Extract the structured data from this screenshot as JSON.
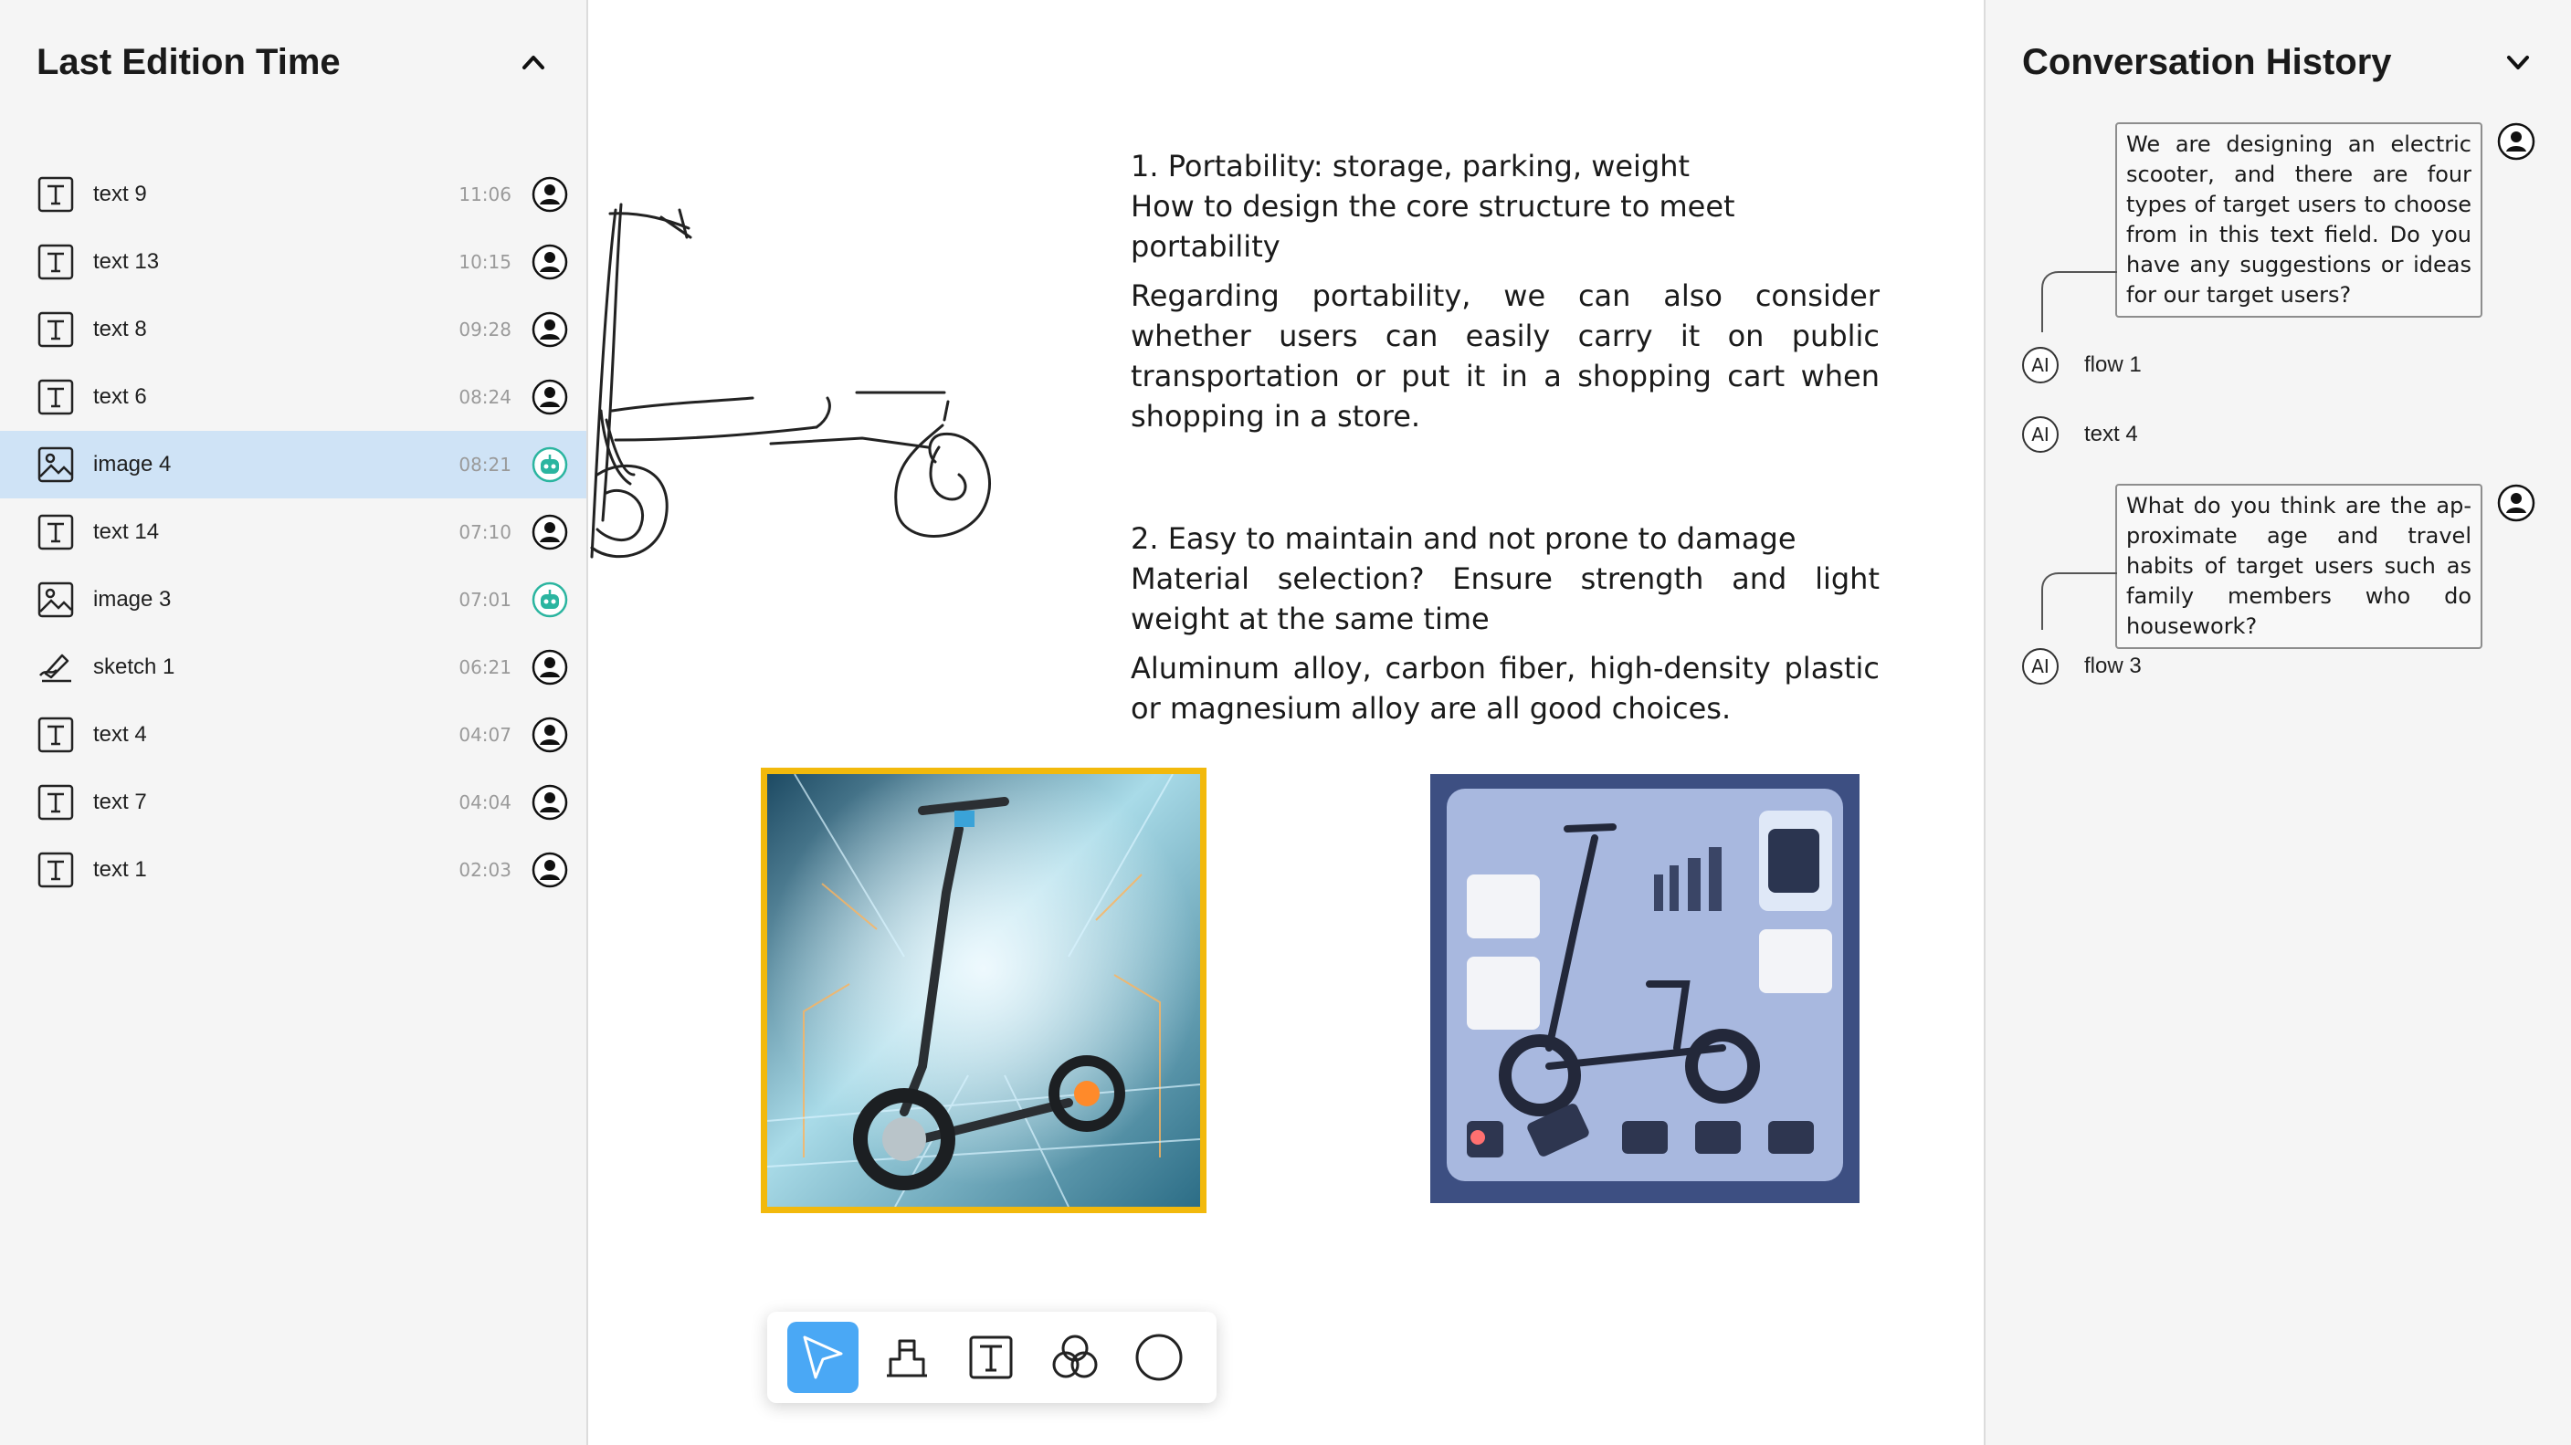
{
  "left_panel": {
    "title": "Last Edition Time",
    "items": [
      {
        "type": "text",
        "label": "text 9",
        "time": "11:06",
        "author": "user"
      },
      {
        "type": "text",
        "label": "text 13",
        "time": "10:15",
        "author": "user"
      },
      {
        "type": "text",
        "label": "text 8",
        "time": "09:28",
        "author": "user"
      },
      {
        "type": "text",
        "label": "text 6",
        "time": "08:24",
        "author": "user"
      },
      {
        "type": "image",
        "label": "image 4",
        "time": "08:21",
        "author": "ai",
        "selected": true
      },
      {
        "type": "text",
        "label": "text 14",
        "time": "07:10",
        "author": "user"
      },
      {
        "type": "image",
        "label": "image 3",
        "time": "07:01",
        "author": "ai"
      },
      {
        "type": "sketch",
        "label": "sketch 1",
        "time": "06:21",
        "author": "user"
      },
      {
        "type": "text",
        "label": "text 4",
        "time": "04:07",
        "author": "user"
      },
      {
        "type": "text",
        "label": "text 7",
        "time": "04:04",
        "author": "user"
      },
      {
        "type": "text",
        "label": "text 1",
        "time": "02:03",
        "author": "user"
      }
    ]
  },
  "canvas": {
    "notes": {
      "block1_line1": "1. Portability: storage, parking, weight",
      "block1_line2": "How to design the core structure to meet portability",
      "block1_para": "Regarding portability, we can also consider whether users can easily carry it on public transportation or put it in a shopping cart when shopping in a store.",
      "block2_line1": "2. Easy to maintain and not prone to damage",
      "block2_line2": "Material selection? Ensure strength and light weight at the same time",
      "block2_para": "Aluminum alloy, carbon fiber, high-density plastic or magnesium alloy are all good choices."
    },
    "images": [
      {
        "name": "image 4",
        "selected": true
      },
      {
        "name": "image 3",
        "selected": false
      }
    ],
    "toolbar": {
      "tools": [
        "select-tool",
        "eraser-tool",
        "text-tool",
        "blend-tool",
        "circle-tool"
      ],
      "active": "select-tool"
    }
  },
  "right_panel": {
    "title": "Conversation History",
    "messages": [
      {
        "role": "user",
        "text": "We are designing an electric scooter, and there are four types of target users to choose from in this text field. Do you have any suggestions or ideas for our target users?"
      },
      {
        "role": "ai",
        "label": "flow 1"
      },
      {
        "role": "ai",
        "label": "text 4"
      },
      {
        "role": "user",
        "text": "What do you think are the ap-proximate age and travel habits of target users such as family members who do housework?"
      },
      {
        "role": "ai",
        "label": "flow 3"
      }
    ],
    "ai_badge": "AI"
  },
  "colors": {
    "selection_highlight": "#cfe3f6",
    "image_selection_border": "#f2b90c",
    "active_tool": "#4aa8f5",
    "ai_author": "#2bb5a0"
  }
}
